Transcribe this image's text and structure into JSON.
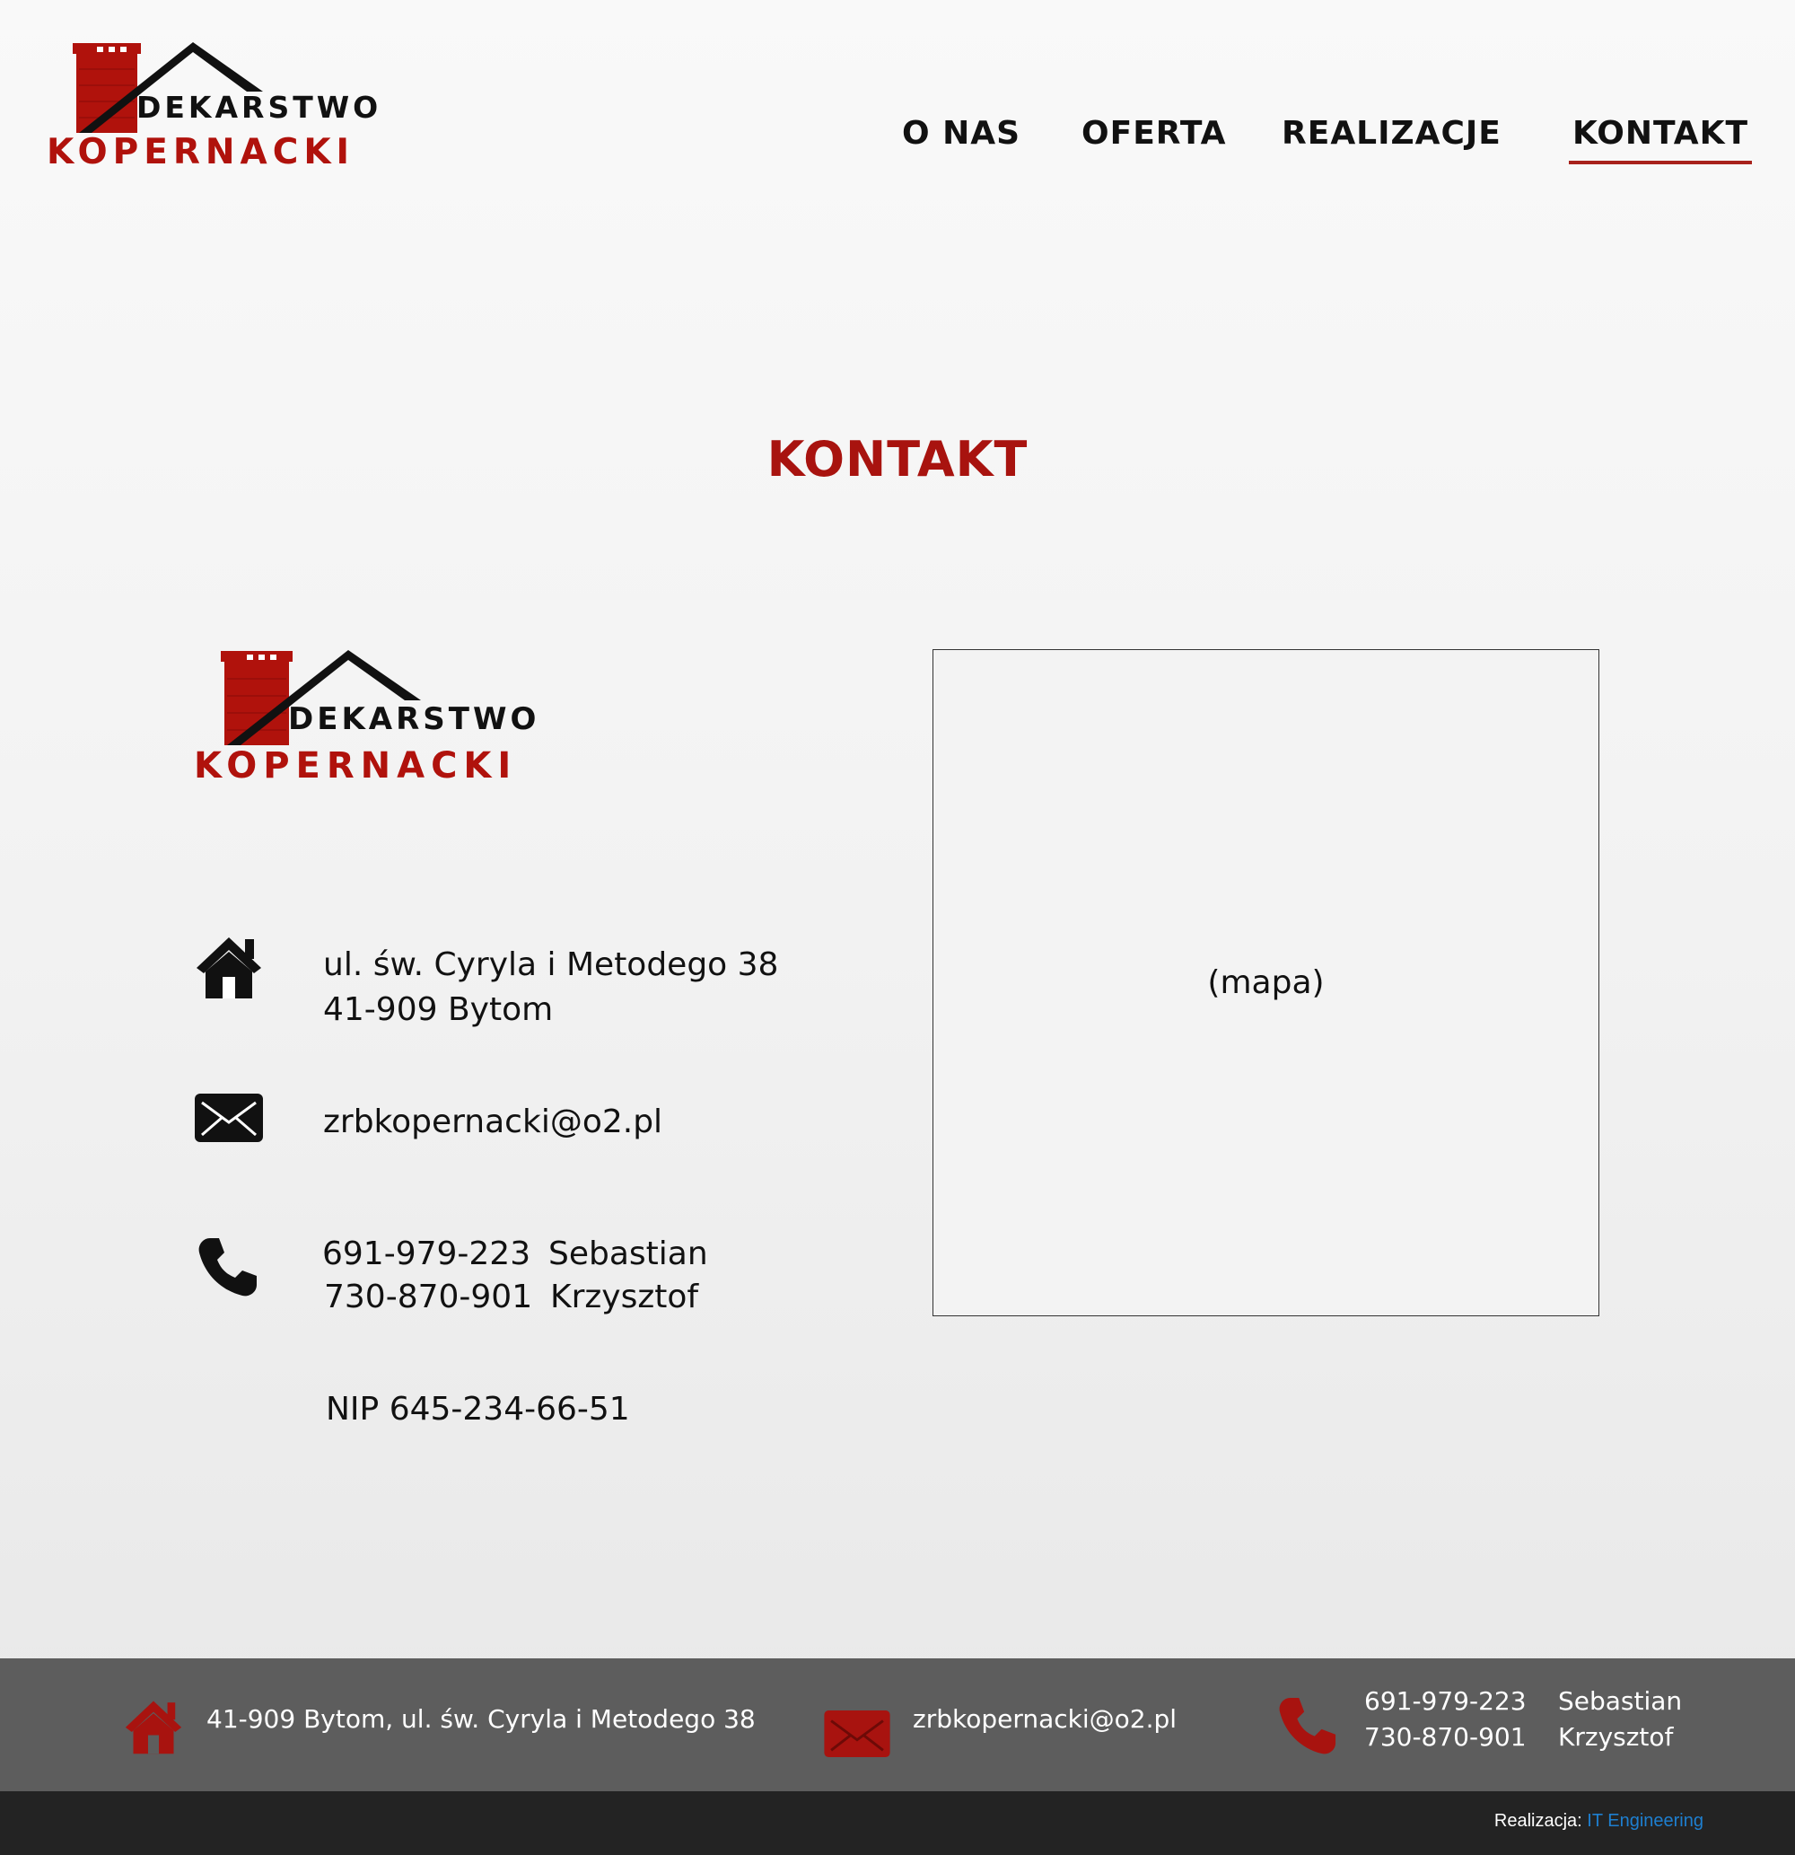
{
  "logo": {
    "line1": "DEKARSTWO",
    "line2": "KOPERNACKI"
  },
  "nav": {
    "items": [
      {
        "label": "O NAS"
      },
      {
        "label": "OFERTA"
      },
      {
        "label": "REALIZACJE"
      },
      {
        "label": "KONTAKT",
        "active": true
      }
    ]
  },
  "page": {
    "title": "KONTAKT"
  },
  "contact": {
    "address_line1": "ul. św. Cyryla i Metodego 38",
    "address_line2": "41-909  Bytom",
    "email": "zrbkopernacki@o2.pl",
    "phones": [
      {
        "number": "691-979-223",
        "name": "Sebastian"
      },
      {
        "number": "730-870-901",
        "name": "Krzysztof"
      }
    ],
    "nip": "NIP 645-234-66-51",
    "icons": [
      "home-icon",
      "mail-icon",
      "phone-icon"
    ]
  },
  "map": {
    "placeholder": "(mapa)"
  },
  "footer": {
    "address": "41-909 Bytom, ul. św. Cyryla i Metodego 38",
    "email": "zrbkopernacki@o2.pl",
    "phones": [
      {
        "number": "691-979-223",
        "name": "Sebastian"
      },
      {
        "number": "730-870-901",
        "name": "Krzysztof"
      }
    ],
    "credit_label": "Realizacja:",
    "credit_link": "IT Engineering"
  },
  "colors": {
    "brand_red": "#a8130f",
    "nav_underline": "#a8221c",
    "footer_bg": "#5d5d5d",
    "bottom_bar_bg": "#232323",
    "credit_link": "#1e7fd0"
  }
}
